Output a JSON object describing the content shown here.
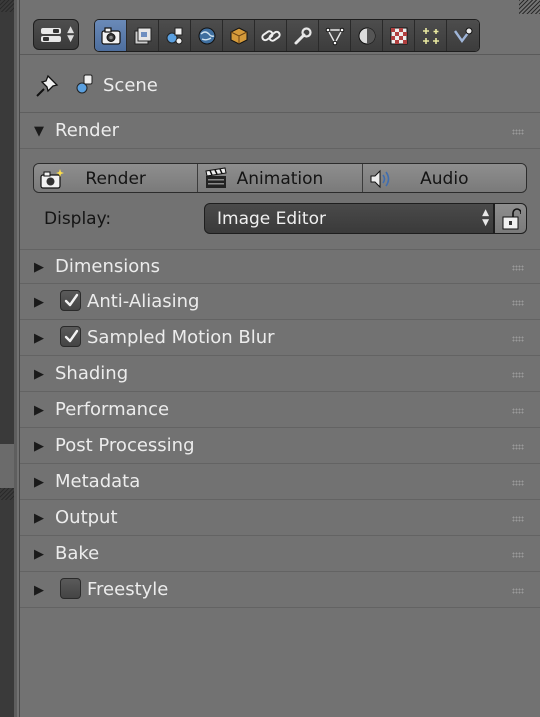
{
  "header": {
    "editor_type_icon": "properties-editor-icon",
    "context_tabs": [
      {
        "name": "render-tab",
        "icon": "camera-icon",
        "active": true
      },
      {
        "name": "render-layers-tab",
        "icon": "render-layers-icon",
        "active": false
      },
      {
        "name": "scene-tab",
        "icon": "scene-icon",
        "active": false
      },
      {
        "name": "world-tab",
        "icon": "world-icon",
        "active": false
      },
      {
        "name": "object-tab",
        "icon": "object-cube-icon",
        "active": false
      },
      {
        "name": "constraints-tab",
        "icon": "constraint-link-icon",
        "active": false
      },
      {
        "name": "modifiers-tab",
        "icon": "wrench-icon",
        "active": false
      },
      {
        "name": "data-tab",
        "icon": "mesh-data-icon",
        "active": false
      },
      {
        "name": "material-tab",
        "icon": "material-sphere-icon",
        "active": false
      },
      {
        "name": "texture-tab",
        "icon": "texture-checker-icon",
        "active": false
      },
      {
        "name": "particles-tab",
        "icon": "particles-icon",
        "active": false
      },
      {
        "name": "physics-tab",
        "icon": "physics-icon",
        "active": false
      }
    ]
  },
  "breadcrumb": {
    "pin_icon": "pin-icon",
    "scene_icon": "scene-icon",
    "label": "Scene"
  },
  "render_panel": {
    "title": "Render",
    "buttons": [
      {
        "label": "Render",
        "icon": "render-camera-icon"
      },
      {
        "label": "Animation",
        "icon": "clapperboard-icon"
      },
      {
        "label": "Audio",
        "icon": "speaker-icon"
      }
    ],
    "display_label": "Display:",
    "display_value": "Image Editor",
    "lock_icon": "lock-icon"
  },
  "sections": [
    {
      "label": "Dimensions",
      "checkbox": null
    },
    {
      "label": "Anti-Aliasing",
      "checkbox": true
    },
    {
      "label": "Sampled Motion Blur",
      "checkbox": true
    },
    {
      "label": "Shading",
      "checkbox": null
    },
    {
      "label": "Performance",
      "checkbox": null
    },
    {
      "label": "Post Processing",
      "checkbox": null
    },
    {
      "label": "Metadata",
      "checkbox": null
    },
    {
      "label": "Output",
      "checkbox": null
    },
    {
      "label": "Bake",
      "checkbox": null
    },
    {
      "label": "Freestyle",
      "checkbox": false
    }
  ],
  "colors": {
    "panel_bg": "#727272",
    "active_tab": "#5a7db0",
    "dark_widget": "#3e3e3e",
    "text_light": "#ececec",
    "text_dark": "#141414"
  }
}
